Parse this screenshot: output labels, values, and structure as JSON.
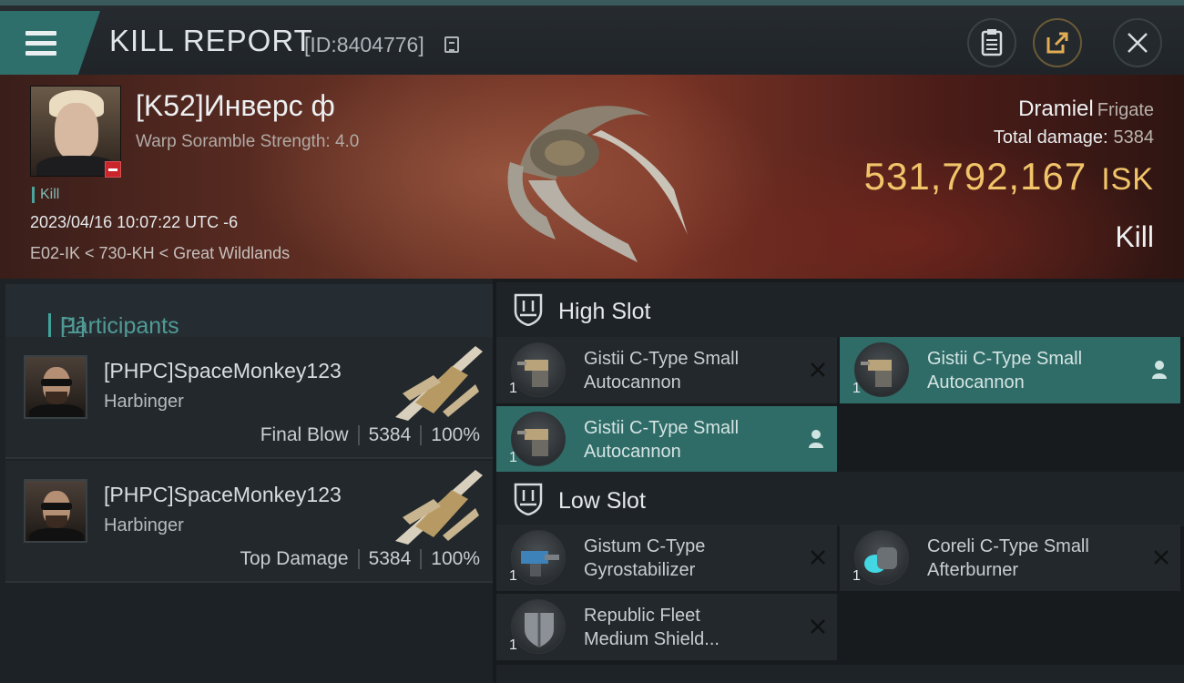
{
  "header": {
    "title": "KILL REPORT",
    "report_id": "[ID:8404776]",
    "icons": [
      "menu-icon",
      "copy-icon",
      "clipboard-icon",
      "share-icon",
      "close-icon"
    ]
  },
  "victim": {
    "name": "[K52]Инверс ф",
    "stat": "Warp Soramble Strength: 4.0",
    "kill_tag": "Kill",
    "date": "2023/04/16 10:07:22 UTC -6",
    "location": "E02-IK < 730-KH < Great Wildlands",
    "ship": "Dramiel",
    "ship_class": "Frigate",
    "total_damage_label": "Total damage:",
    "total_damage": "5384",
    "isk_value": "531,792,167",
    "isk_unit": "ISK",
    "kill_type": "Kill"
  },
  "participants": {
    "header_label": "Participants",
    "count": "[1]",
    "rows": [
      {
        "name": "[PHPC]SpaceMonkey123",
        "ship": "Harbinger",
        "role": "Final Blow",
        "damage": "5384",
        "percent": "100%"
      },
      {
        "name": "[PHPC]SpaceMonkey123",
        "ship": "Harbinger",
        "role": "Top Damage",
        "damage": "5384",
        "percent": "100%"
      }
    ]
  },
  "fittings": {
    "high_slot": {
      "label": "High Slot",
      "modules": [
        {
          "name_line1": "Gistii C-Type Small",
          "name_line2": "Autocannon",
          "qty": "1",
          "state": "destroyed"
        },
        {
          "name_line1": "Gistii C-Type Small",
          "name_line2": "Autocannon",
          "qty": "1",
          "state": "dropped"
        },
        {
          "name_line1": "Gistii C-Type Small",
          "name_line2": "Autocannon",
          "qty": "1",
          "state": "dropped"
        }
      ]
    },
    "low_slot": {
      "label": "Low Slot",
      "modules": [
        {
          "name_line1": "Gistum C-Type",
          "name_line2": "Gyrostabilizer",
          "qty": "1",
          "state": "destroyed"
        },
        {
          "name_line1": "Coreli C-Type Small",
          "name_line2": "Afterburner",
          "qty": "1",
          "state": "destroyed"
        },
        {
          "name_line1": "Republic Fleet",
          "name_line2": "Medium Shield...",
          "qty": "1",
          "state": "destroyed"
        }
      ]
    }
  },
  "colors": {
    "accent_teal": "#2f6c68",
    "isk_gold": "#f1c46a",
    "loss_badge": "#c9252b"
  }
}
